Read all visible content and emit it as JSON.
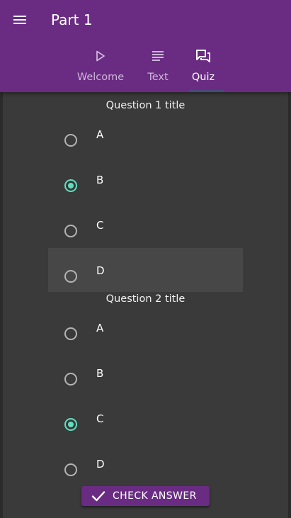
{
  "app_bar": {
    "title": "Part 1",
    "menu_icon": "hamburger-menu-icon",
    "color": "#6a2c82"
  },
  "tabs": [
    {
      "label": "Welcome",
      "icon": "play-icon",
      "active": false
    },
    {
      "label": "Text",
      "icon": "text-lines-icon",
      "active": false
    },
    {
      "label": "Quiz",
      "icon": "chat-bubbles-icon",
      "active": true
    }
  ],
  "questions": [
    {
      "title": "Question 1 title",
      "options": [
        {
          "label": "A",
          "selected": false
        },
        {
          "label": "B",
          "selected": true
        },
        {
          "label": "C",
          "selected": false
        },
        {
          "label": "D",
          "selected": false
        }
      ]
    },
    {
      "title": "Question 2 title",
      "options": [
        {
          "label": "A",
          "selected": false
        },
        {
          "label": "B",
          "selected": false
        },
        {
          "label": "C",
          "selected": true
        },
        {
          "label": "D",
          "selected": false
        }
      ]
    }
  ],
  "check_button": {
    "label": "CHECK ANSWER",
    "icon": "checkmark-icon"
  },
  "colors": {
    "accent": "#5ee0c0",
    "background": "#3a3a3a"
  }
}
